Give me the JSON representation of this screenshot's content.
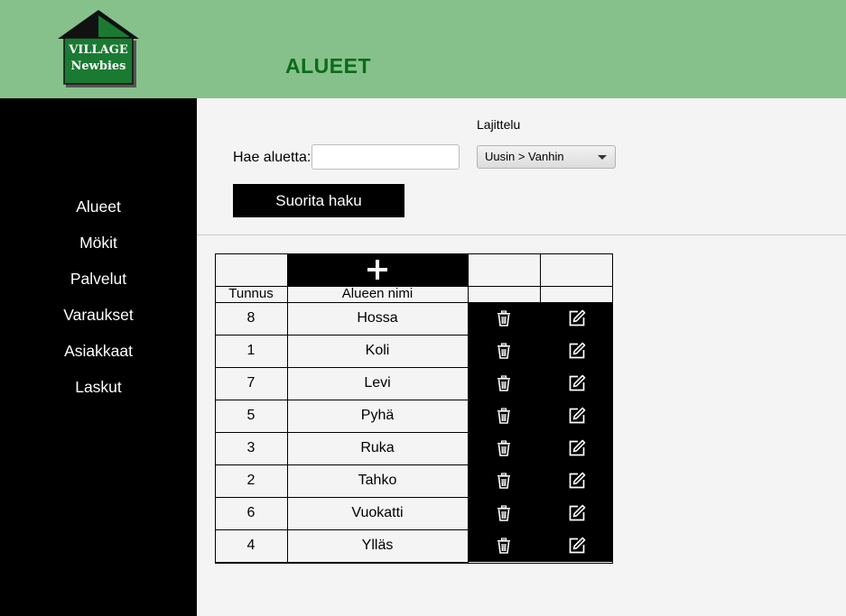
{
  "header": {
    "logo_line1": "VILLAGE",
    "logo_line2": "Newbies",
    "title": "ALUEET"
  },
  "sidebar": {
    "items": [
      {
        "label": "Alueet"
      },
      {
        "label": "Mökit"
      },
      {
        "label": "Palvelut"
      },
      {
        "label": "Varaukset"
      },
      {
        "label": "Asiakkaat"
      },
      {
        "label": "Laskut"
      }
    ]
  },
  "search": {
    "label": "Hae aluetta:",
    "value": "",
    "button_label": "Suorita haku"
  },
  "sort": {
    "label": "Lajittelu",
    "selected": "Uusin > Vanhin"
  },
  "table": {
    "headers": {
      "id": "Tunnus",
      "name": "Alueen nimi"
    },
    "add_icon": "plus-icon",
    "delete_icon": "trash-icon",
    "edit_icon": "edit-icon",
    "rows": [
      {
        "id": "8",
        "name": "Hossa"
      },
      {
        "id": "1",
        "name": "Koli"
      },
      {
        "id": "7",
        "name": "Levi"
      },
      {
        "id": "5",
        "name": "Pyhä"
      },
      {
        "id": "3",
        "name": "Ruka"
      },
      {
        "id": "2",
        "name": "Tahko"
      },
      {
        "id": "6",
        "name": "Vuokatti"
      },
      {
        "id": "4",
        "name": "Ylläs"
      }
    ]
  },
  "colors": {
    "header_bg": "#86c18b",
    "title": "#0b6b1a",
    "logo_green": "#1a7a32",
    "sidebar_bg": "#000000"
  }
}
